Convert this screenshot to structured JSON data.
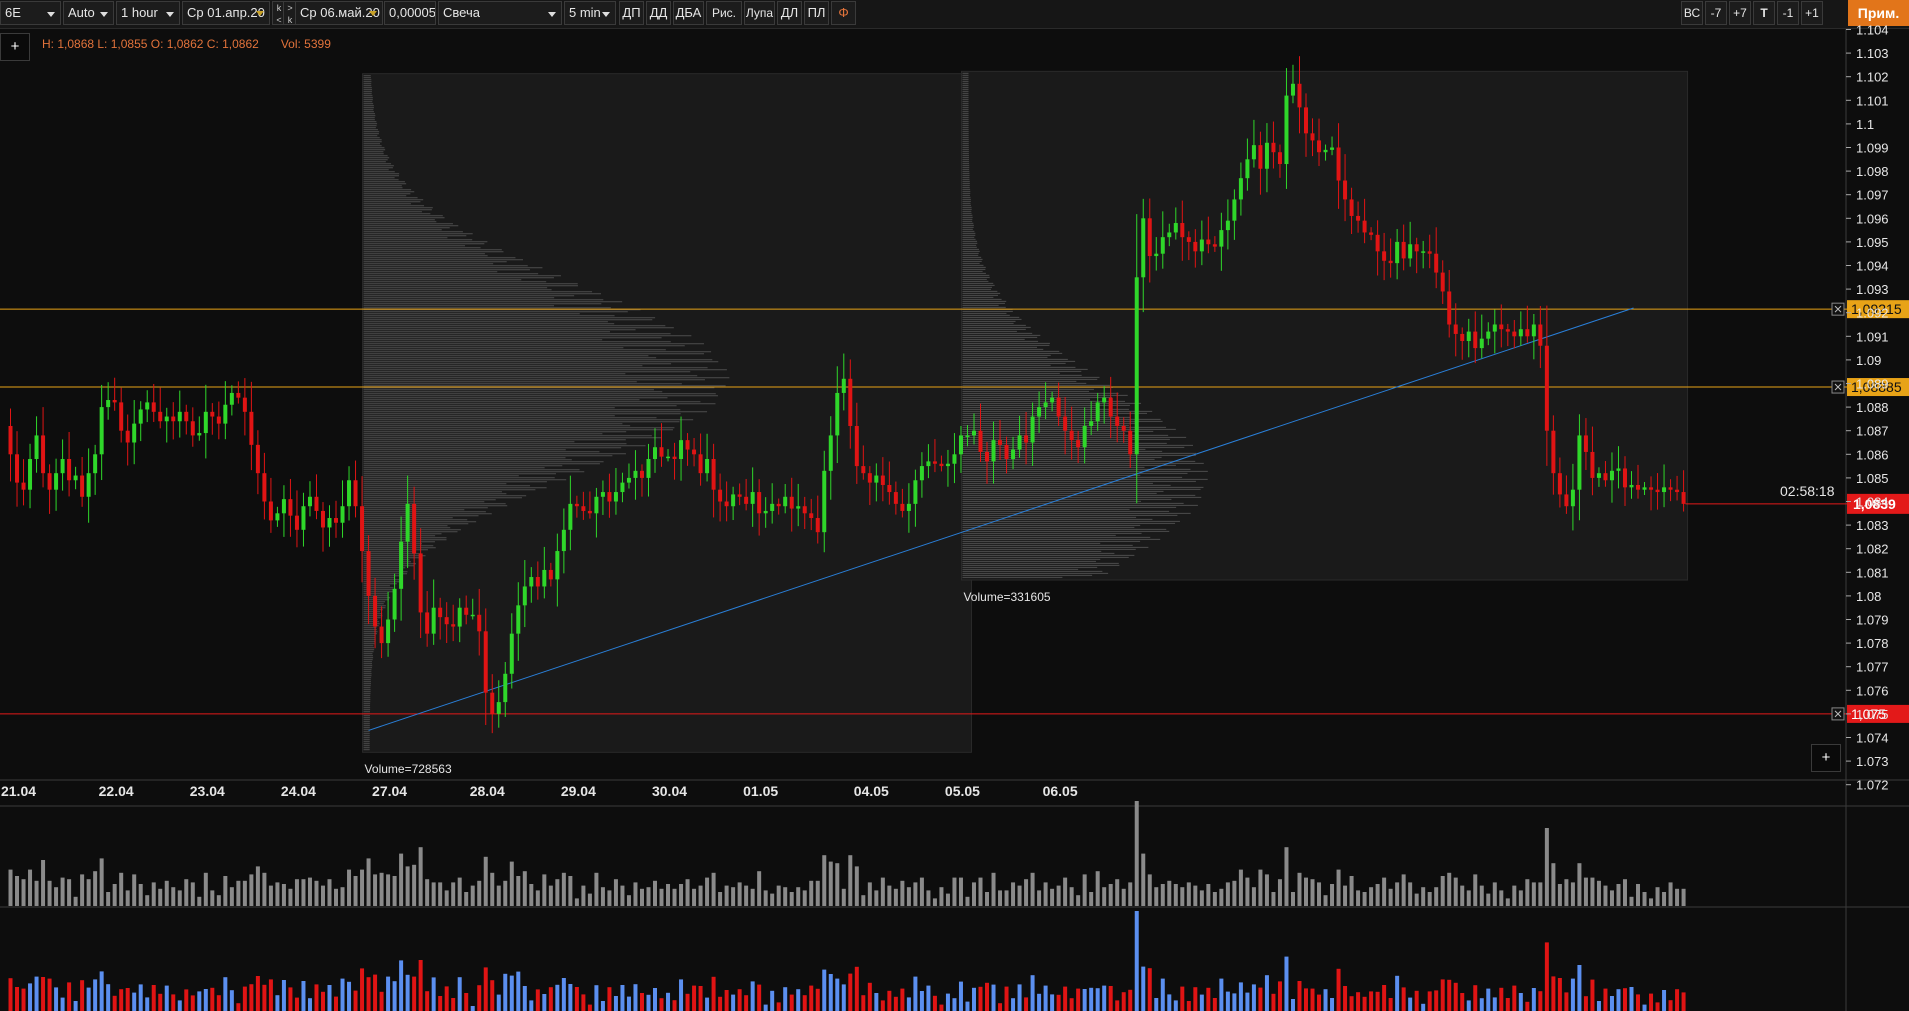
{
  "toolbar": {
    "symbol": "6E",
    "scale_mode": "Auto",
    "timeframe": "1 hour",
    "date_from": "Ср 01.апр.20",
    "nav_a": "k <",
    "nav_b": "> k",
    "date_to": "Ср 06.май.20",
    "tick_size": "0,00005",
    "chart_style": "Свеча",
    "interval": "5 min",
    "tools": [
      "ДП",
      "ДД",
      "ДБА",
      "Рис.",
      "Лупа",
      "ДЛ",
      "ПЛ"
    ],
    "fi_icon": "phi-icon",
    "right_buttons": [
      "ВС",
      "-7",
      "+7",
      "Т",
      "-1",
      "+1"
    ],
    "apply_button": "Прим."
  },
  "info_bar": {
    "ohlc": "H: 1,0868 L: 1,0855 O: 1,0862 C: 1,0862",
    "volume": "Vol: 5399"
  },
  "buttons": {
    "add_top": "+",
    "add_bottom": "+"
  },
  "colors": {
    "up": "#2fd72a",
    "down": "#e01414",
    "level_orange": "#e8a317",
    "level_red": "#e31919",
    "trendline": "#2a7fd8",
    "volume_gray": "#8a8a8a",
    "delta_blue": "#5b8ff0",
    "delta_red": "#e01414",
    "profile": "#4d4d4d"
  },
  "chart_data": {
    "type": "candlestick",
    "price_axis": {
      "ticks": [
        "1.104",
        "1.103",
        "1.102",
        "1.101",
        "1.1",
        "1.099",
        "1.098",
        "1.097",
        "1.096",
        "1.095",
        "1.094",
        "1.093",
        "1.092",
        "1.091",
        "1.09",
        "1.089",
        "1.088",
        "1.087",
        "1.086",
        "1.085",
        "1.084",
        "1.083",
        "1.082",
        "1.081",
        "1.08",
        "1.079",
        "1.078",
        "1.077",
        "1.076",
        "1.075",
        "1.074",
        "1.073",
        "1.072"
      ],
      "range": [
        1.0715,
        1.1043
      ]
    },
    "time_axis": {
      "labels": [
        "21.04",
        "22.04",
        "23.04",
        "24.04",
        "27.04",
        "28.04",
        "29.04",
        "30.04",
        "01.05",
        "04.05",
        "05.05",
        "06.05"
      ]
    },
    "levels": [
      {
        "price": 1.09215,
        "label": "1,09215",
        "color": "orange"
      },
      {
        "price": 1.08885,
        "label": "1,08885",
        "color": "orange"
      },
      {
        "price": 1.075,
        "label": "1,075",
        "color": "red"
      }
    ],
    "current_price": {
      "price": 1.0839,
      "label": "1,0839",
      "countdown": "02:58:18"
    },
    "trendline": {
      "from": {
        "date": "24.04",
        "price": 1.0743
      },
      "to": {
        "date": "05.05",
        "price": 1.0922
      }
    },
    "volume_profiles": [
      {
        "label": "Volume=728563",
        "from": "24.04",
        "to": "01.05",
        "price_range": [
          1.0735,
          1.102
        ]
      },
      {
        "label": "Volume=331605",
        "from": "01.05",
        "to": "06.05",
        "price_range": [
          1.0808,
          1.1021
        ]
      }
    ],
    "series": [
      {
        "name": "price",
        "values": [
          1.0872,
          1.086,
          1.0848,
          1.0845,
          1.0858,
          1.0868,
          1.0852,
          1.0845,
          1.0852,
          1.0858,
          1.0849,
          1.0851,
          1.0842,
          1.0852,
          1.086,
          1.088,
          1.0883,
          1.0882,
          1.087,
          1.0865,
          1.0873,
          1.0879,
          1.0882,
          1.0878,
          1.0874,
          1.0876,
          1.0874,
          1.0878,
          1.0874,
          1.0868,
          1.0869,
          1.0878,
          1.0876,
          1.0873,
          1.0881,
          1.0886,
          1.0884,
          1.0878,
          1.0864,
          1.0852,
          1.084,
          1.0832,
          1.0835,
          1.0841,
          1.0834,
          1.0828,
          1.0838,
          1.0842,
          1.0836,
          1.0829,
          1.0833,
          1.0831,
          1.0838,
          1.0849,
          1.0838,
          1.0819,
          1.08,
          1.0787,
          1.078,
          1.079,
          1.0803,
          1.0823,
          1.0839,
          1.0818,
          1.0793,
          1.0784,
          1.0795,
          1.0791,
          1.0788,
          1.0787,
          1.0795,
          1.0792,
          1.0792,
          1.0785,
          1.0759,
          1.075,
          1.0755,
          1.0767,
          1.0784,
          1.0796,
          1.0804,
          1.0808,
          1.0804,
          1.0811,
          1.0807,
          1.0819,
          1.0828,
          1.0839,
          1.0838,
          1.0836,
          1.0835,
          1.0842,
          1.0844,
          1.084,
          1.0844,
          1.0848,
          1.085,
          1.0853,
          1.085,
          1.0858,
          1.0863,
          1.0859,
          1.0859,
          1.0858,
          1.0866,
          1.0862,
          1.086,
          1.0852,
          1.0858,
          1.0845,
          1.084,
          1.0838,
          1.0843,
          1.0842,
          1.0839,
          1.0844,
          1.0835,
          1.0836,
          1.0839,
          1.0838,
          1.0842,
          1.0837,
          1.0838,
          1.0835,
          1.0833,
          1.0827,
          1.0853,
          1.0868,
          1.0886,
          1.0892,
          1.0872,
          1.0855,
          1.0852,
          1.0848,
          1.0851,
          1.0847,
          1.0844,
          1.0839,
          1.0836,
          1.0839,
          1.0849,
          1.0855,
          1.0857,
          1.0856,
          1.0855,
          1.0856,
          1.086,
          1.0868,
          1.0868,
          1.087,
          1.0861,
          1.0857,
          1.0866,
          1.0864,
          1.0858,
          1.0862,
          1.0868,
          1.0865,
          1.0876,
          1.088,
          1.0882,
          1.0884,
          1.0876,
          1.087,
          1.0866,
          1.0863,
          1.0872,
          1.0874,
          1.0882,
          1.0884,
          1.0876,
          1.0872,
          1.087,
          1.086,
          1.0935,
          1.096,
          1.0944,
          1.0945,
          1.0952,
          1.0954,
          1.0958,
          1.0952,
          1.095,
          1.0946,
          1.0951,
          1.0949,
          1.0948,
          1.0955,
          1.0959,
          1.0968,
          1.0977,
          1.0985,
          1.0991,
          1.0981,
          1.0992,
          1.0988,
          1.0983,
          1.1012,
          1.1017,
          1.1007,
          1.0996,
          1.0993,
          1.0988,
          1.0989,
          1.099,
          1.0976,
          1.0968,
          1.0961,
          1.0959,
          1.0954,
          1.0953,
          1.0946,
          1.0942,
          1.0941,
          1.095,
          1.0943,
          1.0949,
          1.0946,
          1.0946,
          1.0945,
          1.0937,
          1.0929,
          1.0915,
          1.0911,
          1.0908,
          1.0912,
          1.0905,
          1.0909,
          1.0912,
          1.0915,
          1.0913,
          1.0912,
          1.091,
          1.0913,
          1.091,
          1.0915,
          1.0906,
          1.087,
          1.0852,
          1.0843,
          1.0838,
          1.0845,
          1.0868,
          1.0861,
          1.085,
          1.0852,
          1.0849,
          1.0853,
          1.0854,
          1.0846,
          1.0847,
          1.0845,
          1.0846,
          1.0845,
          1.0844,
          1.0846,
          1.0845,
          1.0844,
          1.0839
        ]
      }
    ]
  }
}
